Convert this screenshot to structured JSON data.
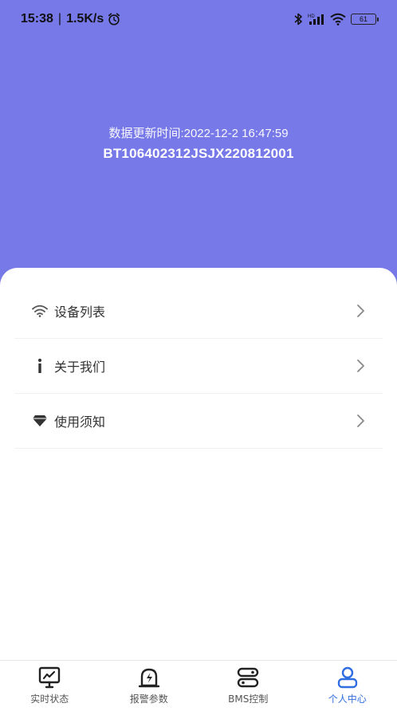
{
  "status": {
    "time": "15:38",
    "network_speed": "1.5K/s",
    "battery": "61",
    "icons": [
      "alarm-icon",
      "bluetooth-icon",
      "signal-icon",
      "wifi-icon",
      "battery-icon"
    ]
  },
  "header": {
    "update_time": "数据更新时间:2022-12-2 16:47:59",
    "device_id": "BT106402312JSJX220812001",
    "background": "#7779e8"
  },
  "menu": {
    "items": [
      {
        "label": "设备列表",
        "icon": "wifi-icon"
      },
      {
        "label": "关于我们",
        "icon": "info-icon"
      },
      {
        "label": "使用须知",
        "icon": "gem-icon"
      }
    ]
  },
  "tabbar": {
    "active_color": "#2f6de0",
    "tabs": [
      {
        "label": "实时状态",
        "icon": "monitor-icon"
      },
      {
        "label": "报警参数",
        "icon": "alarm-bolt-icon"
      },
      {
        "label": "BMS控制",
        "icon": "server-icon"
      },
      {
        "label": "个人中心",
        "icon": "user-icon",
        "active": true
      }
    ]
  }
}
